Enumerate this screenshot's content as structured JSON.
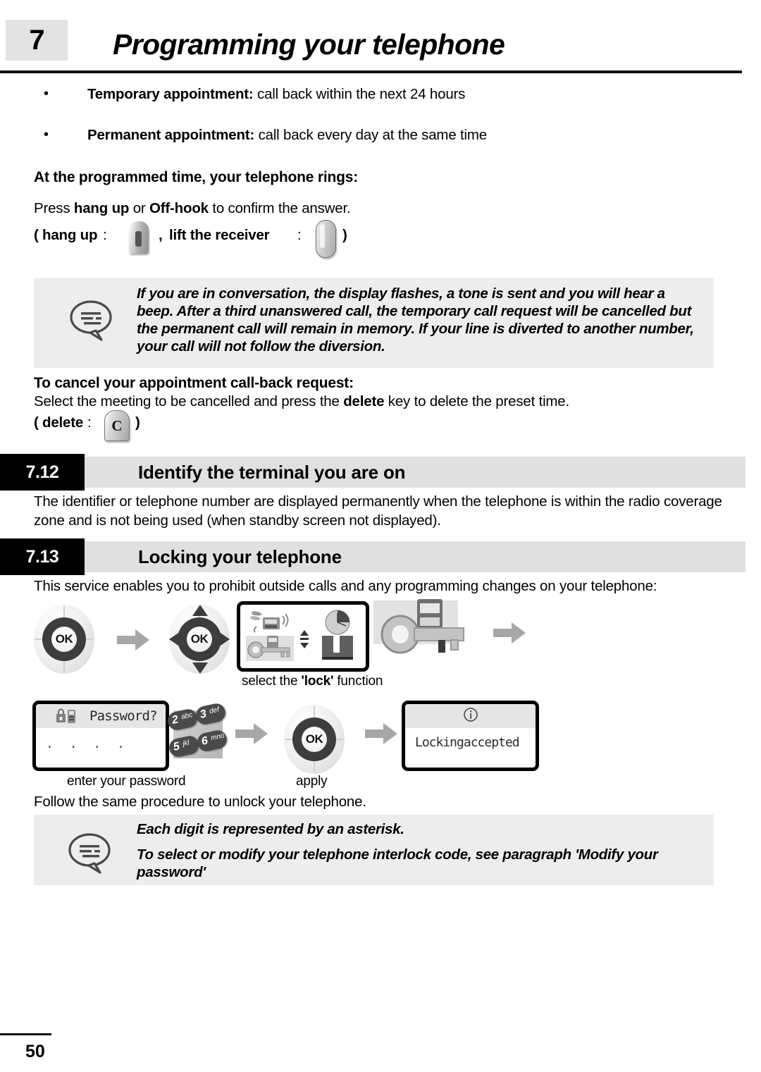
{
  "header": {
    "chapter_number": "7",
    "chapter_title": "Programming your telephone"
  },
  "bullets": [
    {
      "bold": "Temporary appointment:",
      "rest": " call back within the next 24 hours"
    },
    {
      "bold": "Permanent appointment:",
      "rest": " call back every day at the same time"
    }
  ],
  "appointment": {
    "subheading": "At the programmed time, your telephone rings:",
    "press_line_1": "Press ",
    "press_bold_1": "hang up",
    "press_mid": " or ",
    "press_bold_2": "Off-hook",
    "press_end": " to confirm the answer.",
    "keys_open_paren": "(",
    "keys_hangup_label": "hang up",
    "keys_colon": " : ",
    "keys_comma": ", ",
    "keys_lift_label": "lift the receiver",
    "keys_close_paren": ")"
  },
  "note_1": {
    "icon": "speech-bubble-icon",
    "text": "If you are in conversation, the display flashes, a tone is sent and you will hear a beep. After a third unanswered call, the temporary call request will be cancelled but the permanent call will remain in memory. If your line is diverted to another number, your call will not follow the diversion."
  },
  "cancel_request": {
    "heading": "To cancel your appointment call-back request:",
    "line_pre": "Select the meeting to be cancelled and press the ",
    "line_bold": "delete",
    "line_post": " key to delete the preset time.",
    "key_open_paren": "(",
    "key_label": "delete",
    "key_colon": " : ",
    "key_glyph": "C",
    "key_close_paren": ")"
  },
  "section_7_12": {
    "number": "7.12",
    "title": "Identify the terminal you are on",
    "body": "The identifier or telephone number are displayed permanently when the telephone is within the radio coverage zone and is not being used (when standby screen not displayed)."
  },
  "section_7_13": {
    "number": "7.13",
    "title": "Locking your telephone",
    "body": "This service enables you to prohibit outside calls and any programming changes on your telephone:",
    "ok_label": "OK",
    "caption_select_lock_pre": "select the ",
    "caption_select_lock_bold": "'lock'",
    "caption_select_lock_post": " function",
    "password_screen": {
      "title": "Password?",
      "dots": ". . . .",
      "icon": "lock-phone-icon"
    },
    "keypad_keys": [
      {
        "digit": "2",
        "letters": "abc"
      },
      {
        "digit": "3",
        "letters": "def"
      },
      {
        "digit": "5",
        "letters": "jkl"
      },
      {
        "digit": "6",
        "letters": "mno"
      }
    ],
    "caption_enter_password": "enter your password",
    "caption_apply": "apply",
    "result_screen": {
      "icon": "info-icon",
      "text": "Lockingaccepted"
    },
    "unlock_note": "Follow the same procedure to unlock your telephone."
  },
  "note_2": {
    "icon": "speech-bubble-icon",
    "line_1": "Each digit is represented by an asterisk.",
    "line_2": "To select or modify your telephone interlock code, see paragraph 'Modify your password'"
  },
  "footer": {
    "page_number": "50"
  },
  "colors": {
    "note_background": "#ededed",
    "section_band": "#e0e0e0",
    "section_number_bg": "#000000",
    "chapter_box_bg": "#e3e3e3",
    "arrow_grey": "#a7a7a7"
  }
}
